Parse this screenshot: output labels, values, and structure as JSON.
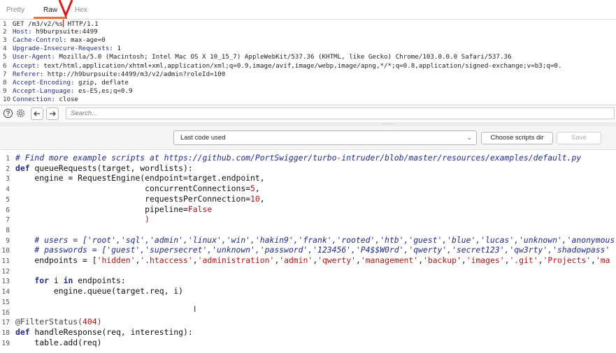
{
  "tabs": [
    {
      "label": "Pretty"
    },
    {
      "label": "Raw"
    },
    {
      "label": "Hex"
    }
  ],
  "request_lines": [
    {
      "num": "1",
      "key": "",
      "text": "GET /m3/v2/%s",
      "after": " HTTP/1.1"
    },
    {
      "num": "2",
      "key": "Host:",
      "text": " h9burpsuite:4499",
      "after": ""
    },
    {
      "num": "3",
      "key": "Cache-Control:",
      "text": " max-age=0",
      "after": ""
    },
    {
      "num": "4",
      "key": "Upgrade-Insecure-Requests:",
      "text": " 1",
      "after": ""
    },
    {
      "num": "5",
      "key": "User-Agent:",
      "text": " Mozilla/5.0 (Macintosh; Intel Mac OS X 10_15_7) AppleWebKit/537.36 (KHTML, like Gecko) Chrome/103.0.0.0 Safari/537.36",
      "after": ""
    },
    {
      "num": "6",
      "key": "Accept:",
      "text": " text/html,application/xhtml+xml,application/xml;q=0.9,image/avif,image/webp,image/apng,*/*;q=0.8,application/signed-exchange;v=b3;q=0.",
      "after": ""
    },
    {
      "num": "7",
      "key": "Referer:",
      "text": " http://h9burpsuite:4499/m3/v2/admin?roleId=100",
      "after": ""
    },
    {
      "num": "8",
      "key": "Accept-Encoding:",
      "text": " gzip, deflate",
      "after": ""
    },
    {
      "num": "9",
      "key": "Accept-Language:",
      "text": " es-ES,es;q=0.9",
      "after": ""
    },
    {
      "num": "10",
      "key": "Connection:",
      "text": " close",
      "after": ""
    }
  ],
  "search": {
    "placeholder": "Search..."
  },
  "toolbar": {
    "script_select_value": "Last code used",
    "choose_dir_label": "Choose scripts dir",
    "save_label": "Save"
  },
  "code_lines": [
    {
      "num": "1",
      "segs": [
        {
          "c": "cm",
          "t": "# Find more example scripts at https://github.com/PortSwigger/turbo-intruder/blob/master/resources/examples/default.py"
        }
      ]
    },
    {
      "num": "2",
      "segs": [
        {
          "c": "kw",
          "t": "def "
        },
        {
          "c": "fn",
          "t": "queueRequests(target, wordlists):"
        }
      ]
    },
    {
      "num": "3",
      "segs": [
        {
          "c": "fn",
          "t": "    engine = RequestEngine(endpoint=target.endpoint,"
        }
      ]
    },
    {
      "num": "4",
      "segs": [
        {
          "c": "fn",
          "t": "                           concurrentConnections="
        },
        {
          "c": "num",
          "t": "5"
        },
        {
          "c": "fn",
          "t": ","
        }
      ]
    },
    {
      "num": "5",
      "segs": [
        {
          "c": "fn",
          "t": "                           requestsPerConnection="
        },
        {
          "c": "num",
          "t": "10"
        },
        {
          "c": "fn",
          "t": ","
        }
      ]
    },
    {
      "num": "6",
      "segs": [
        {
          "c": "fn",
          "t": "                           pipeline="
        },
        {
          "c": "num",
          "t": "False"
        }
      ]
    },
    {
      "num": "7",
      "segs": [
        {
          "c": "str",
          "t": "                           )"
        }
      ]
    },
    {
      "num": "8",
      "segs": [
        {
          "c": "fn",
          "t": ""
        }
      ]
    },
    {
      "num": "9",
      "segs": [
        {
          "c": "cm",
          "t": "    # users = ['root','sql','admin','linux','win','hakin9','frank','rooted','htb','guest','blue','lucas','unknown','anonymous'"
        }
      ]
    },
    {
      "num": "10",
      "segs": [
        {
          "c": "cm",
          "t": "    # passwords = ['guest','supersecret','unknown','password','123456','P4$$W0rd','qwerty','secret123','qw3rty','shadowpass'"
        }
      ]
    },
    {
      "num": "11",
      "segs": [
        {
          "c": "fn",
          "t": "    endpoints = ["
        },
        {
          "c": "str",
          "t": "'hidden'"
        },
        {
          "c": "fn",
          "t": ","
        },
        {
          "c": "str",
          "t": "'.htaccess'"
        },
        {
          "c": "fn",
          "t": ","
        },
        {
          "c": "str",
          "t": "'administration'"
        },
        {
          "c": "fn",
          "t": ","
        },
        {
          "c": "str",
          "t": "'admin'"
        },
        {
          "c": "fn",
          "t": ","
        },
        {
          "c": "str",
          "t": "'qwerty'"
        },
        {
          "c": "fn",
          "t": ","
        },
        {
          "c": "str",
          "t": "'management'"
        },
        {
          "c": "fn",
          "t": ","
        },
        {
          "c": "str",
          "t": "'backup'"
        },
        {
          "c": "fn",
          "t": ","
        },
        {
          "c": "str",
          "t": "'images'"
        },
        {
          "c": "fn",
          "t": ","
        },
        {
          "c": "str",
          "t": "'.git'"
        },
        {
          "c": "fn",
          "t": ","
        },
        {
          "c": "str",
          "t": "'Projects'"
        },
        {
          "c": "fn",
          "t": ","
        },
        {
          "c": "str",
          "t": "'ma"
        }
      ]
    },
    {
      "num": "12",
      "segs": [
        {
          "c": "fn",
          "t": ""
        }
      ]
    },
    {
      "num": "13",
      "segs": [
        {
          "c": "kw",
          "t": "    for "
        },
        {
          "c": "fn",
          "t": "i "
        },
        {
          "c": "kw",
          "t": "in "
        },
        {
          "c": "fn",
          "t": "endpoints:"
        }
      ]
    },
    {
      "num": "14",
      "segs": [
        {
          "c": "fn",
          "t": "        engine.queue(target.req, i)"
        }
      ]
    },
    {
      "num": "15",
      "segs": [
        {
          "c": "fn",
          "t": ""
        }
      ]
    },
    {
      "num": "16",
      "segs": [
        {
          "c": "fn",
          "t": ""
        }
      ]
    },
    {
      "num": "17",
      "segs": [
        {
          "c": "dec",
          "t": "@FilterStatus("
        },
        {
          "c": "num",
          "t": "404"
        },
        {
          "c": "dec",
          "t": ")"
        }
      ]
    },
    {
      "num": "18",
      "segs": [
        {
          "c": "kw",
          "t": "def "
        },
        {
          "c": "fn",
          "t": "handleResponse(req, interesting):"
        }
      ]
    },
    {
      "num": "19",
      "segs": [
        {
          "c": "fn",
          "t": "    table.add(req)"
        }
      ]
    }
  ],
  "colors": {
    "accent": "#e8743b",
    "annotation_red": "#e01818"
  }
}
